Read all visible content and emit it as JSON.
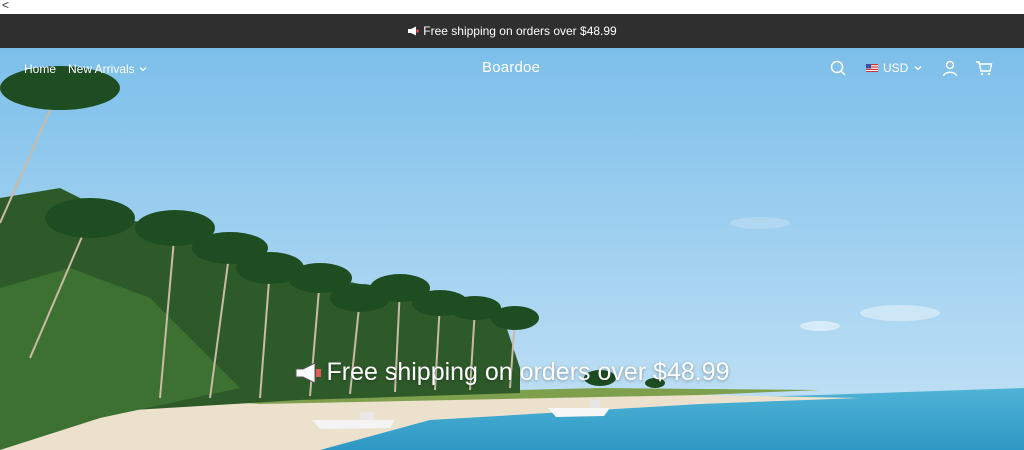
{
  "browser": {
    "back_char": "<"
  },
  "announcement": {
    "icon": "megaphone-icon",
    "text": "Free shipping on orders over $48.99"
  },
  "nav": {
    "links": [
      {
        "label": "Home"
      },
      {
        "label": "New Arrivals",
        "has_dropdown": true
      }
    ],
    "brand": "Boardoe",
    "currency": "USD",
    "icons": [
      "search-icon",
      "flag-icon",
      "account-icon",
      "cart-icon"
    ]
  },
  "hero": {
    "headline": "Free shipping on orders over $48.99",
    "icon": "megaphone-icon"
  },
  "colors": {
    "announcement_bg": "#2f2f2f",
    "sky": "#8cc6ec",
    "sea": "#3fa9cf"
  }
}
